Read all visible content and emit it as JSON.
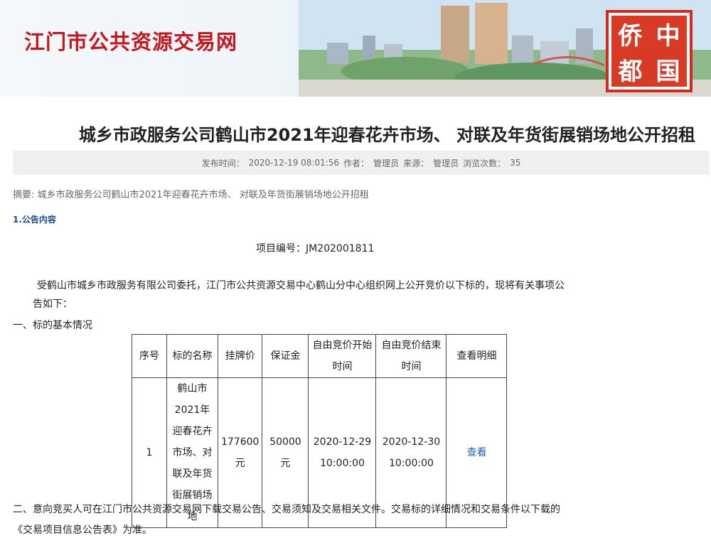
{
  "banner": {
    "site_title": "江门市公共资源交易网",
    "seal_chars": [
      "侨",
      "中",
      "都",
      "国"
    ],
    "colors": {
      "title": "#c8161d",
      "seal": "#d83a26"
    }
  },
  "article": {
    "title": "城乡市政服务公司鹤山市2021年迎春花卉市场、 对联及年货街展销场地公开招租",
    "meta": {
      "publish_label": "发布时间：",
      "publish_time": "2020-12-19 08:01:56",
      "author_label": "作者：",
      "author": "管理员",
      "source_label": "来源：",
      "source": "管理员",
      "views_label": "浏览次数：",
      "views": "35"
    },
    "summary": "摘要: 城乡市政服务公司鹤山市2021年迎春花卉市场、 对联及年货街展销场地公开招租",
    "section_heading": "1.公告内容",
    "project_no": "项目编号：JM202001811",
    "intro_line1": "受鹤山市城乡市政服务有限公司委托，江门市公共资源交易中心鹤山分中心组织网上公开竞价以下标的，现将有关事项公",
    "intro_line2": "告如下：",
    "sub1": "一、标的基本情况",
    "table": {
      "headers": [
        "序号",
        "标的名称",
        "挂牌价",
        "保证金",
        "自由竞价开始时间",
        "自由竞价结束时间",
        "查看明细"
      ],
      "rows": [
        {
          "no": "1",
          "name": "鹤山市2021年迎春花卉市场、对联及年货街展销场地",
          "price": "177600元",
          "deposit": "50000元",
          "start": "2020-12-29 10:00:00",
          "end": "2020-12-30 10:00:00",
          "view": "查看"
        }
      ]
    },
    "sub2_line1": "二、意向竞买人可在江门市公共资源交易网下载交易公告、交易须知及交易相关文件。交易标的详细情况和交易条件以下载的",
    "sub2_line2": "《交易项目信息公告表》为准。"
  }
}
